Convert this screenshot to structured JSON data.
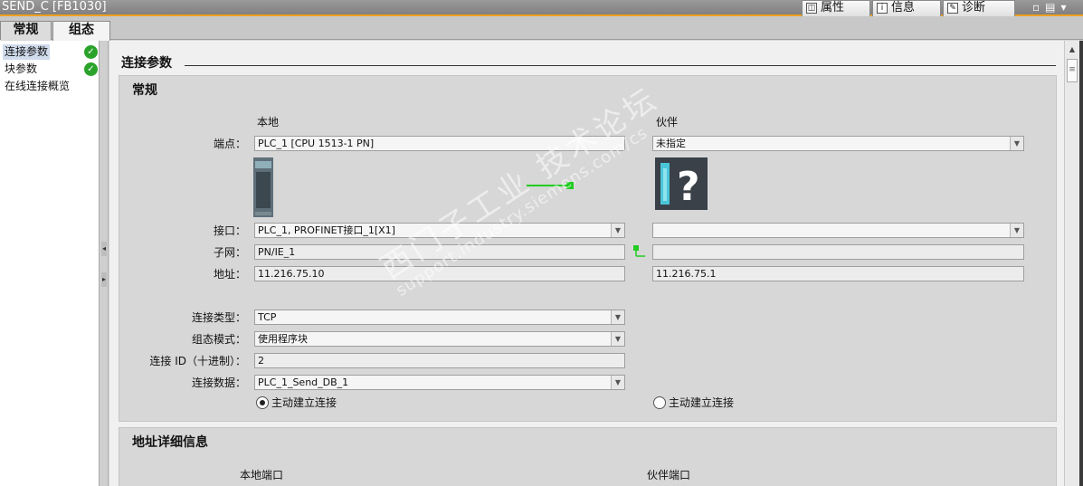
{
  "title": "SEND_C [FB1030]",
  "inspector_tabs": [
    {
      "label": "属性",
      "icon": "properties-icon"
    },
    {
      "label": "信息",
      "icon": "info-icon"
    },
    {
      "label": "诊断",
      "icon": "diagnostics-icon"
    }
  ],
  "tabs": [
    {
      "label": "常规"
    },
    {
      "label": "组态"
    }
  ],
  "nav": [
    {
      "label": "连接参数",
      "ok": true
    },
    {
      "label": "块参数",
      "ok": true
    },
    {
      "label": "在线连接概览",
      "ok": false
    }
  ],
  "main": {
    "section_title": "连接参数",
    "general": {
      "title": "常规",
      "col_local": "本地",
      "col_partner": "伙伴",
      "endpoint_label": "端点：",
      "endpoint_local": "PLC_1 [CPU 1513-1 PN]",
      "endpoint_partner": "未指定",
      "interface_label": "接口：",
      "interface_local": "PLC_1, PROFINET接口_1[X1]",
      "interface_partner": "",
      "subnet_label": "子网：",
      "subnet_local": "PN/IE_1",
      "subnet_partner": "",
      "address_label": "地址：",
      "address_local": "11.216.75.10",
      "address_partner": "11.216.75.1",
      "conn_type_label": "连接类型：",
      "conn_type": "TCP",
      "config_mode_label": "组态模式：",
      "config_mode": "使用程序块",
      "conn_id_label": "连接 ID（十进制）：",
      "conn_id": "2",
      "conn_data_label": "连接数据：",
      "conn_data": "PLC_1_Send_DB_1",
      "active_local_label": "主动建立连接",
      "active_local_selected": true,
      "active_partner_label": "主动建立连接",
      "active_partner_selected": false
    },
    "address_details": {
      "title": "地址详细信息",
      "local_port": "本地端口",
      "partner_port": "伙伴端口"
    }
  },
  "watermark": {
    "line1": "西门子工业 技术论坛",
    "line2": "support.industry.siemens.com/cs"
  },
  "colors": {
    "accent": "#f0a020",
    "ok_green": "#2ba32b",
    "link_green": "#22cc22"
  }
}
